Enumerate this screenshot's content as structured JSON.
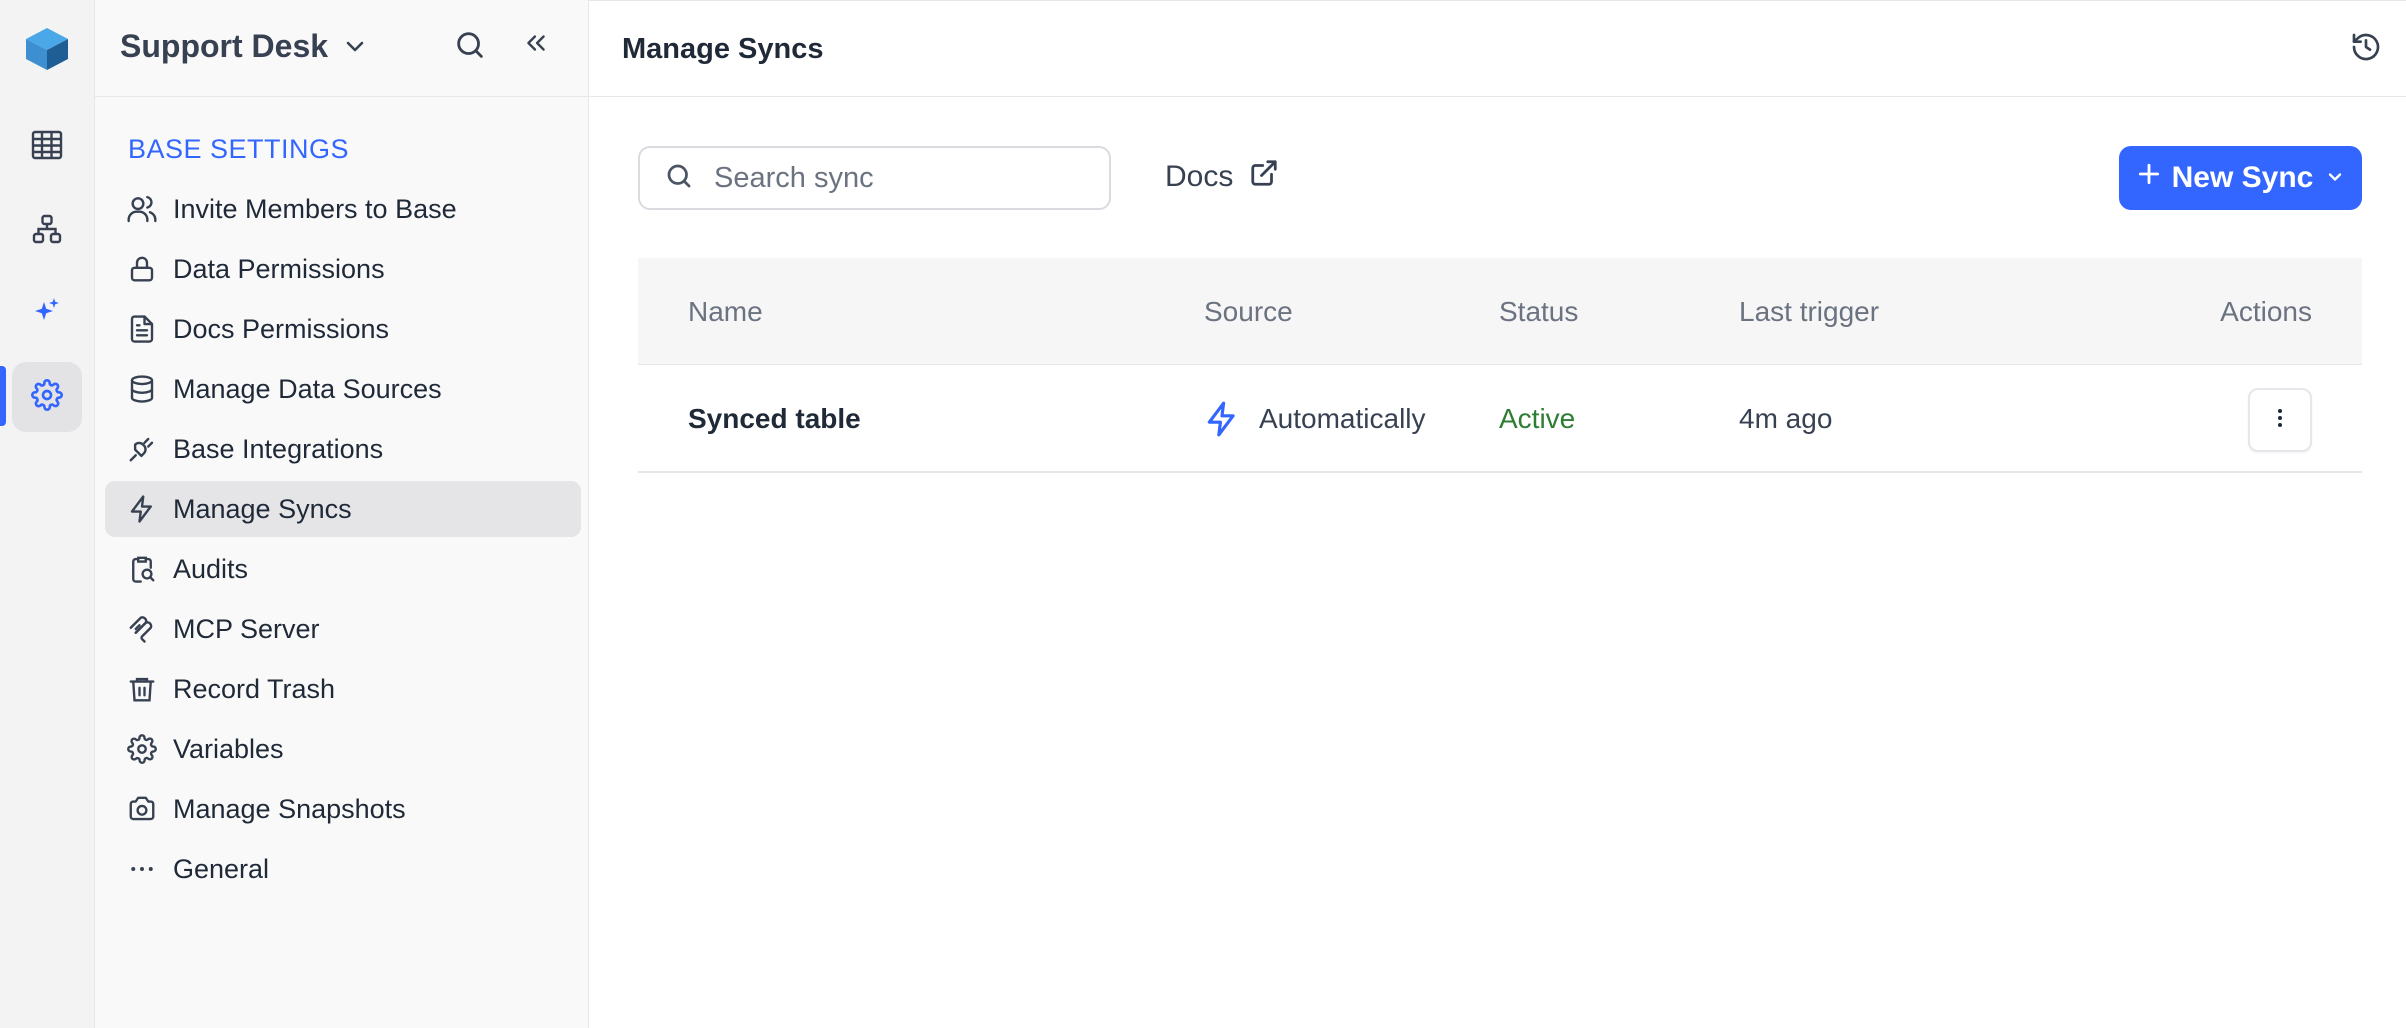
{
  "workspace": {
    "name": "Support Desk"
  },
  "sidebar": {
    "section_label": "BASE SETTINGS",
    "items": [
      {
        "label": "Invite Members to Base",
        "icon": "users-icon"
      },
      {
        "label": "Data Permissions",
        "icon": "lock-icon"
      },
      {
        "label": "Docs Permissions",
        "icon": "document-icon"
      },
      {
        "label": "Manage Data Sources",
        "icon": "database-icon"
      },
      {
        "label": "Base Integrations",
        "icon": "plug-icon"
      },
      {
        "label": "Manage Syncs",
        "icon": "lightning-icon",
        "active": true
      },
      {
        "label": "Audits",
        "icon": "audit-icon"
      },
      {
        "label": "MCP Server",
        "icon": "mcp-icon"
      },
      {
        "label": "Record Trash",
        "icon": "trash-icon"
      },
      {
        "label": "Variables",
        "icon": "gear-icon"
      },
      {
        "label": "Manage Snapshots",
        "icon": "camera-icon"
      },
      {
        "label": "General",
        "icon": "more-horizontal-icon"
      }
    ]
  },
  "header": {
    "title": "Manage Syncs"
  },
  "toolbar": {
    "search_placeholder": "Search sync",
    "docs_label": "Docs",
    "new_sync_label": "New Sync"
  },
  "table": {
    "columns": [
      "Name",
      "Source",
      "Status",
      "Last trigger",
      "Actions"
    ],
    "rows": [
      {
        "name": "Synced table",
        "source": "Automatically",
        "status": "Active",
        "last_trigger": "4m ago"
      }
    ]
  },
  "colors": {
    "accent": "#3366ff",
    "status_active": "#2e7d32"
  }
}
